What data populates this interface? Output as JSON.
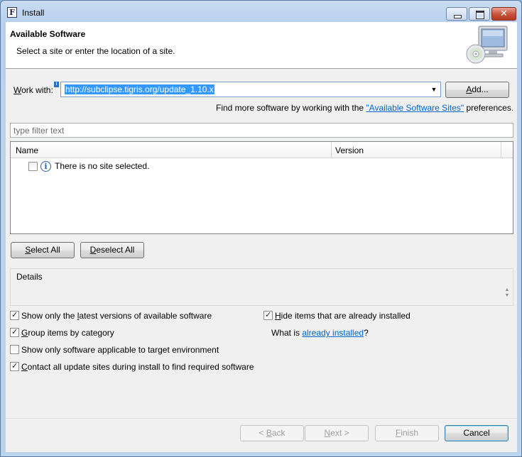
{
  "window": {
    "title": "Install",
    "app_icon_letter": "F"
  },
  "header": {
    "title": "Available Software",
    "description": "Select a site or enter the location of a site."
  },
  "work_with": {
    "label_prefix": "W",
    "label_rest": "ork with:",
    "value": "http://subclipse.tigris.org/update_1.10.x",
    "add_button": {
      "mnemonic": "A",
      "rest": "dd..."
    }
  },
  "find_more": {
    "prefix": "Find more software by working with the ",
    "link": "\"Available Software Sites\"",
    "suffix": " preferences."
  },
  "filter": {
    "placeholder": "type filter text"
  },
  "table": {
    "columns": [
      "Name",
      "Version"
    ],
    "rows": [
      {
        "checked": false,
        "text": "There is no site selected."
      }
    ]
  },
  "select_buttons": {
    "select_all": {
      "mnemonic": "S",
      "rest": "elect All"
    },
    "deselect_all": {
      "mnemonic": "D",
      "rest": "eselect All"
    }
  },
  "details": {
    "label": "Details"
  },
  "options": {
    "latest_versions": {
      "checked": true,
      "before": "Show only the ",
      "mnemonic": "l",
      "after": "atest versions of available software"
    },
    "group_by_category": {
      "checked": true,
      "before": "",
      "mnemonic": "G",
      "after": "roup items by category"
    },
    "target_env": {
      "checked": false,
      "text": "Show only software applicable to target environment"
    },
    "contact_sites": {
      "checked": true,
      "before": "",
      "mnemonic": "C",
      "after": "ontact all update sites during install to find required software"
    },
    "hide_installed": {
      "checked": true,
      "before": "",
      "mnemonic": "H",
      "after": "ide items that are already installed"
    },
    "what_is": {
      "prefix": "What is ",
      "link": "already installed",
      "suffix": "?"
    }
  },
  "footer": {
    "back": {
      "before": "< ",
      "mnemonic": "B",
      "after": "ack"
    },
    "next": {
      "mnemonic": "N",
      "after": "ext >"
    },
    "finish": {
      "mnemonic": "F",
      "after": "inish"
    },
    "cancel": "Cancel"
  }
}
